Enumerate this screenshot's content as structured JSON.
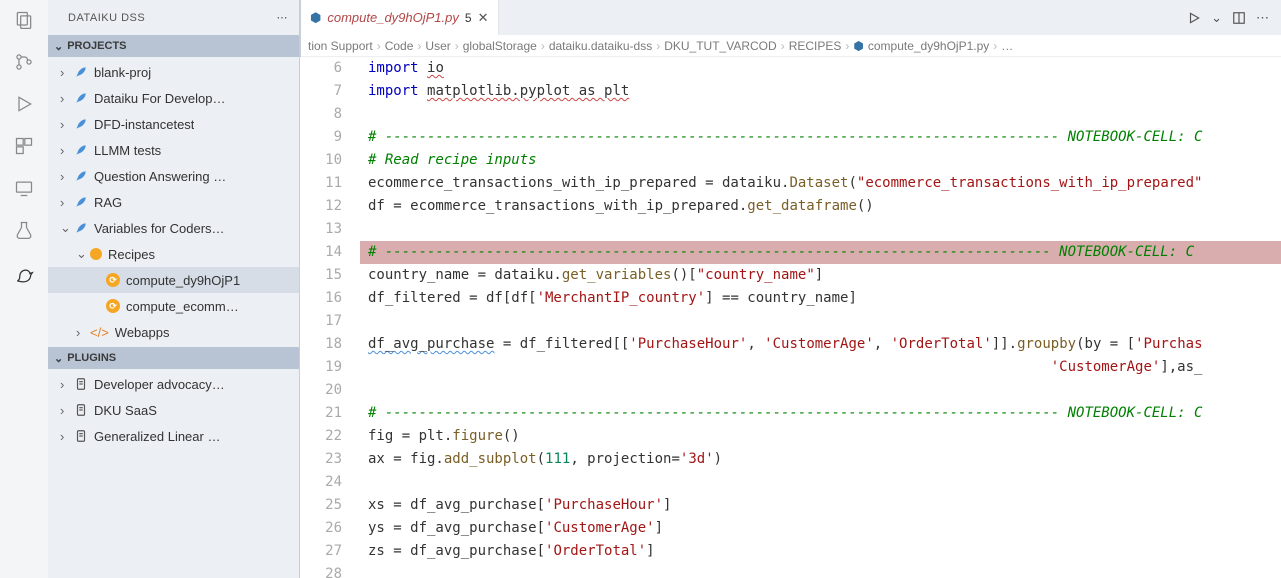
{
  "sidebar": {
    "title": "DATAIKU DSS",
    "sections": [
      {
        "label": "PROJECTS"
      },
      {
        "label": "PLUGINS"
      }
    ],
    "projects": [
      {
        "label": "blank-proj",
        "depth": 0,
        "icon": "feather",
        "expandable": true
      },
      {
        "label": "Dataiku For Develop…",
        "depth": 0,
        "icon": "feather",
        "expandable": true
      },
      {
        "label": "DFD-instancetest",
        "depth": 0,
        "icon": "feather",
        "expandable": true
      },
      {
        "label": "LLMM tests",
        "depth": 0,
        "icon": "feather",
        "expandable": true
      },
      {
        "label": "Question Answering …",
        "depth": 0,
        "icon": "feather",
        "expandable": true
      },
      {
        "label": "RAG",
        "depth": 0,
        "icon": "feather",
        "expandable": true
      },
      {
        "label": "Variables for Coders…",
        "depth": 0,
        "icon": "feather",
        "expandable": true,
        "expanded": true
      },
      {
        "label": "Recipes",
        "depth": 1,
        "icon": "circle-orange",
        "expandable": true,
        "expanded": true
      },
      {
        "label": "compute_dy9hOjP1",
        "depth": 2,
        "icon": "pyrecipe",
        "selected": true
      },
      {
        "label": "compute_ecomm…",
        "depth": 2,
        "icon": "pyrecipe"
      },
      {
        "label": "Webapps",
        "depth": 1,
        "icon": "tag",
        "expandable": true
      }
    ],
    "plugins": [
      {
        "label": "Developer advocacy…",
        "depth": 0,
        "icon": "db",
        "expandable": true
      },
      {
        "label": "DKU SaaS",
        "depth": 0,
        "icon": "db",
        "expandable": true
      },
      {
        "label": "Generalized Linear …",
        "depth": 0,
        "icon": "db",
        "expandable": true
      }
    ]
  },
  "tab": {
    "filename": "compute_dy9hOjP1.py",
    "modifications": "5"
  },
  "breadcrumb": [
    "tion Support",
    "Code",
    "User",
    "globalStorage",
    "dataiku.dataiku-dss",
    "DKU_TUT_VARCOD",
    "RECIPES",
    "compute_dy9hOjP1.py",
    "…"
  ],
  "editor": {
    "first_line": 6,
    "lines": [
      {
        "t": "import io",
        "cls": "sq-under"
      },
      {
        "t": "import matplotlib.pyplot as plt",
        "cls": "sq-under"
      },
      {
        "t": ""
      },
      {
        "t": "# -------------------------------------------------------------------------------- NOTEBOOK-CELL: C",
        "cls": "cmt"
      },
      {
        "t": "# Read recipe inputs",
        "cls": "cmt"
      },
      {
        "html": "ecommerce_transactions_with_ip_prepared = dataiku.<span class='fn'>Dataset</span>(<span class='str'>\"ecommerce_transactions_with_ip_prepared\"</span>"
      },
      {
        "html": "df = ecommerce_transactions_with_ip_prepared.<span class='fn'>get_dataframe</span>()"
      },
      {
        "t": ""
      },
      {
        "t": "# ------------------------------------------------------------------------------- NOTEBOOK-CELL: C",
        "cls": "cmt",
        "hl": true
      },
      {
        "html": "country_name = dataiku.<span class='fn'>get_variables</span>()[<span class='str'>\"country_name\"</span>]"
      },
      {
        "html": "df_filtered = df[df[<span class='str'>'MerchantIP_country'</span>] == country_name]"
      },
      {
        "t": ""
      },
      {
        "html": "<span class='sq-under-b'>df_avg_purchase</span> = df_filtered[[<span class='str'>'PurchaseHour'</span>, <span class='str'>'CustomerAge'</span>, <span class='str'>'OrderTotal'</span>]].<span class='fn'>groupby</span>(<span>by</span> = [<span class='str'>'Purchas</span>"
      },
      {
        "html": "                                                                                 <span class='str'>'CustomerAge'</span>],as_"
      },
      {
        "t": ""
      },
      {
        "t": "# -------------------------------------------------------------------------------- NOTEBOOK-CELL: C",
        "cls": "cmt"
      },
      {
        "html": "fig = plt.<span class='fn'>figure</span>()"
      },
      {
        "html": "ax = fig.<span class='fn'>add_subplot</span>(<span class='num'>111</span>, <span>projection</span>=<span class='str'>'3d'</span>)"
      },
      {
        "t": ""
      },
      {
        "html": "xs = df_avg_purchase[<span class='str'>'PurchaseHour'</span>]"
      },
      {
        "html": "ys = df_avg_purchase[<span class='str'>'CustomerAge'</span>]"
      },
      {
        "html": "zs = df_avg_purchase[<span class='str'>'OrderTotal'</span>]"
      },
      {
        "t": ""
      }
    ]
  }
}
